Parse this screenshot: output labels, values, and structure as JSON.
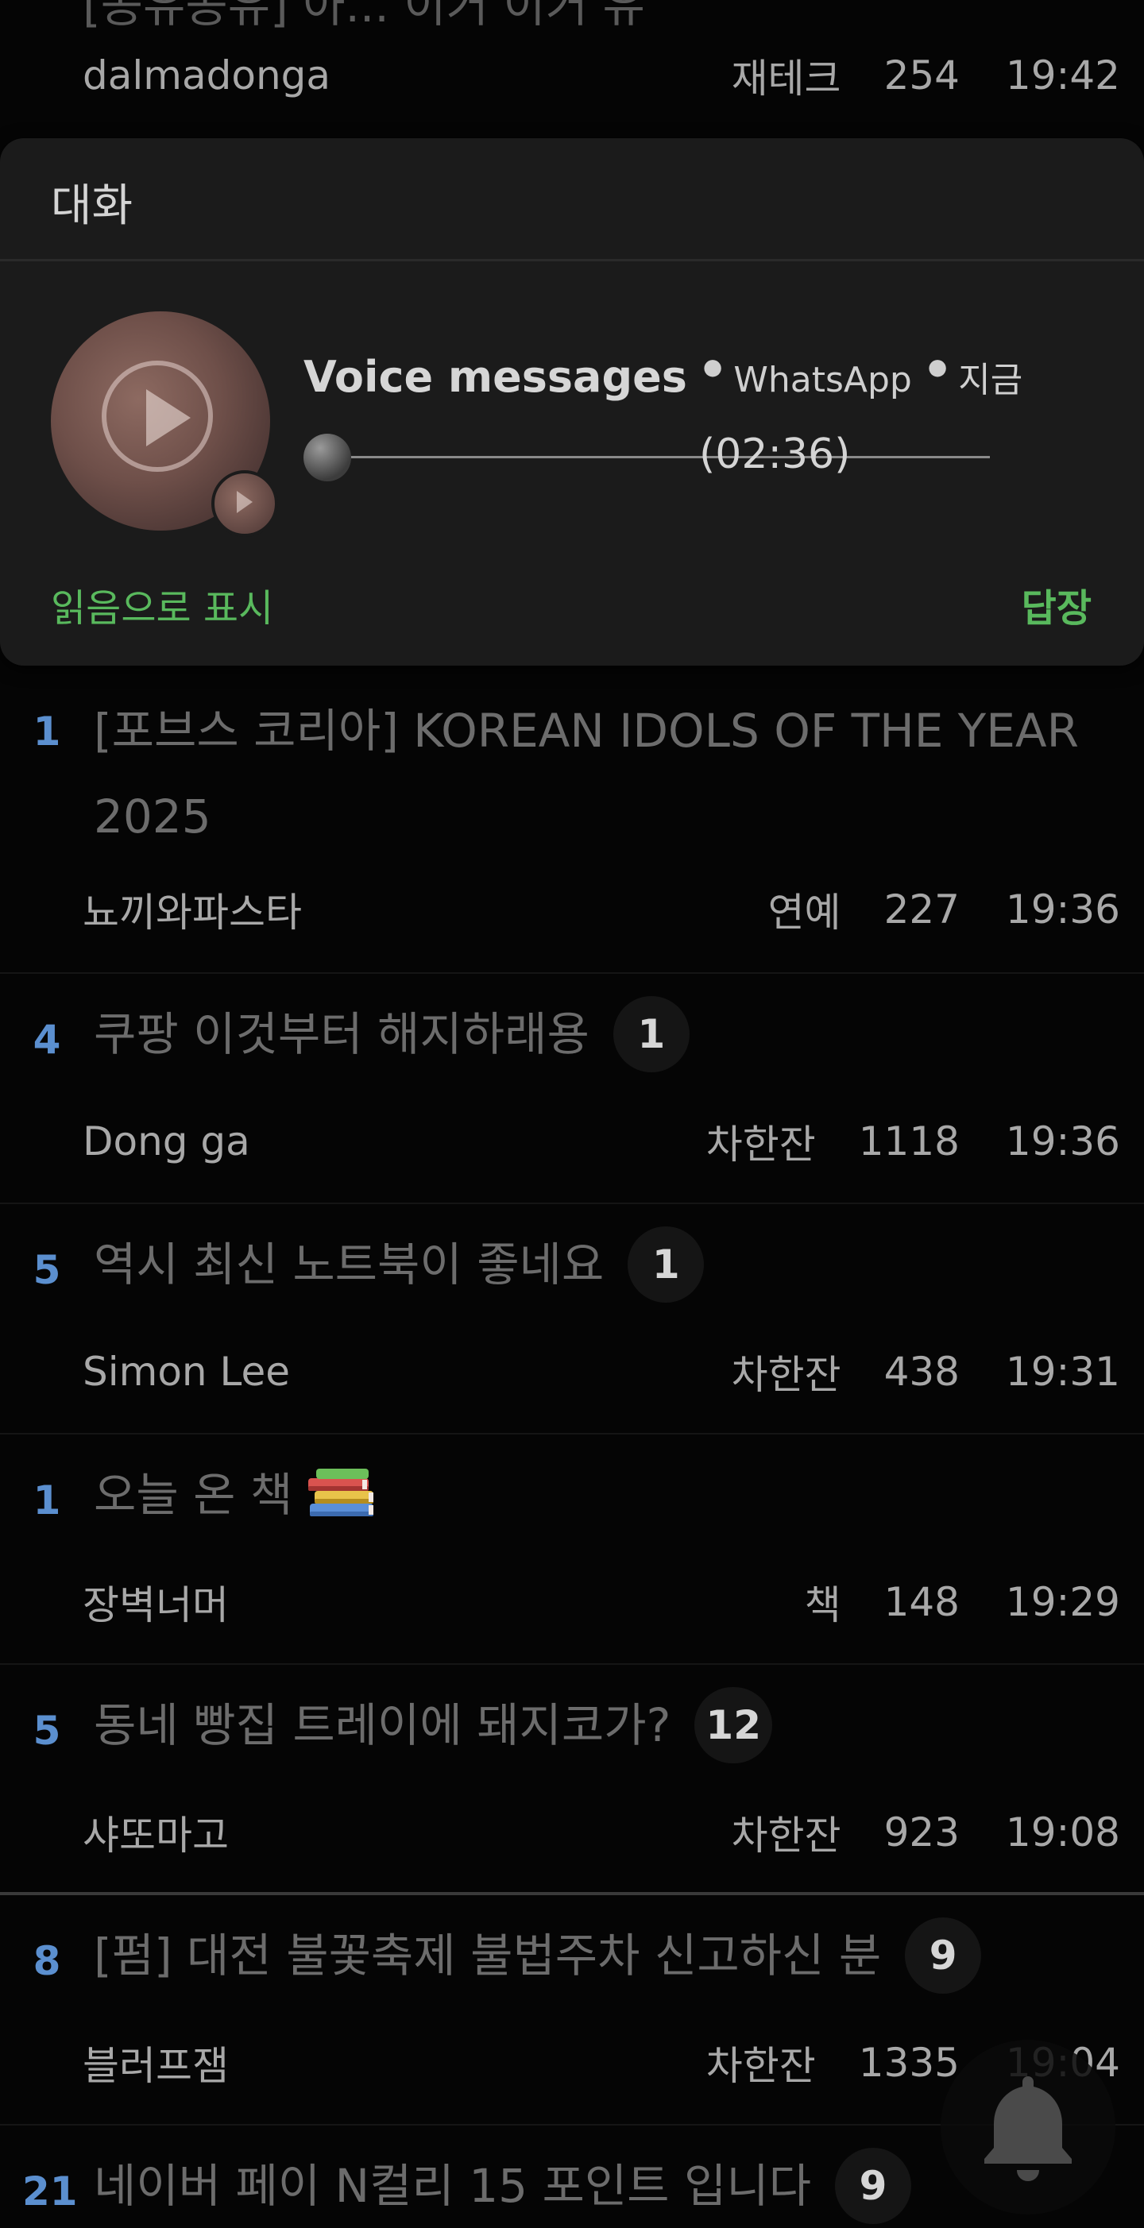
{
  "top_partial": {
    "title_fragment": "[공유공유] 아... 이거 이거 유",
    "author": "dalmadonga",
    "category": "재테크",
    "views": "254",
    "time": "19:42"
  },
  "notification": {
    "group_label": "대화",
    "title": "Voice messages",
    "app": "WhatsApp",
    "when": "지금",
    "duration": "(02:36)",
    "playback_progress": 0,
    "mark_read_label": "읽음으로 표시",
    "reply_label": "답장",
    "accent_color": "#59b95d"
  },
  "posts": [
    {
      "rank": "1",
      "title": "[포브스 코리아] KOREAN IDOLS OF THE YEAR 2025",
      "comments": "",
      "author": "뇨끼와파스타",
      "category": "연예",
      "views": "227",
      "time": "19:36"
    },
    {
      "rank": "4",
      "title": "쿠팡 이것부터 해지하래용",
      "comments": "1",
      "author": "Dong ga",
      "category": "차한잔",
      "views": "1118",
      "time": "19:36"
    },
    {
      "rank": "5",
      "title": "역시 최신 노트북이 좋네요",
      "comments": "1",
      "author": "Simon Lee",
      "category": "차한잔",
      "views": "438",
      "time": "19:31"
    },
    {
      "rank": "1",
      "title": "오늘 온 책",
      "comments": "",
      "author": "장벽너머",
      "category": "책",
      "views": "148",
      "time": "19:29"
    },
    {
      "rank": "5",
      "title": "동네 빵집 트레이에 돼지코가?",
      "comments": "12",
      "author": "샤또마고",
      "category": "차한잔",
      "views": "923",
      "time": "19:08"
    },
    {
      "rank": "8",
      "title": "[펌] 대전 불꽃축제 불법주차 신고하신 분",
      "comments": "9",
      "author": "블러프잼",
      "category": "차한잔",
      "views": "1335",
      "time": "19:04"
    },
    {
      "rank": "21",
      "title": "네이버 페이 N컬리 15 포인트 입니다",
      "comments": "9",
      "author": "",
      "category": "",
      "views": "",
      "time": ""
    }
  ],
  "icons": {
    "play": "play-icon",
    "bell": "bell-icon",
    "books": "books-emoji-icon"
  }
}
